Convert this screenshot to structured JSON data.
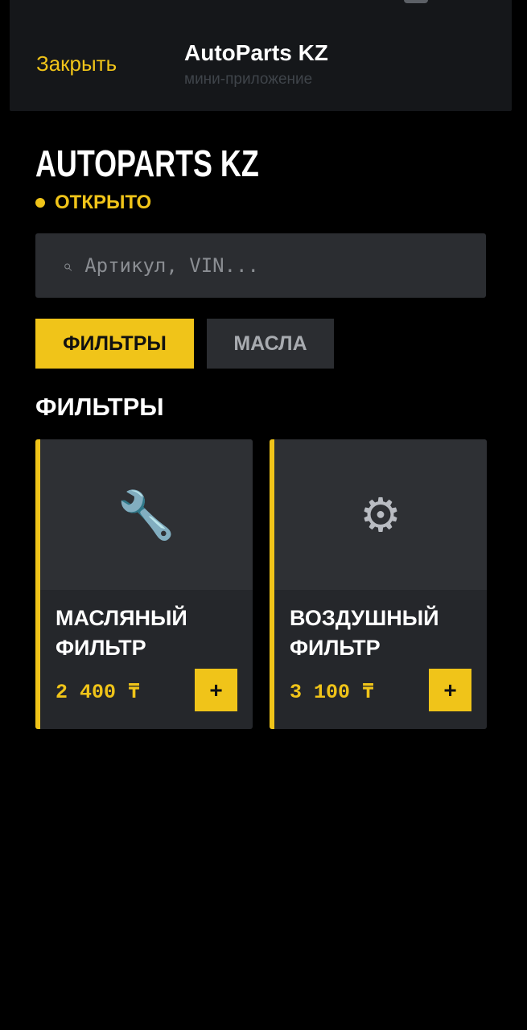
{
  "header": {
    "close_label": "Закрыть",
    "title": "AutoParts KZ",
    "subtitle": "мини-приложение"
  },
  "shop": {
    "name": "AUTOPARTS KZ",
    "status": "ОТКРЫТО"
  },
  "search": {
    "icon": "search-icon",
    "icon_glyph": "⌕",
    "placeholder": "Артикул, VIN...",
    "value": ""
  },
  "tabs": [
    {
      "label": "ФИЛЬТРЫ",
      "active": true
    },
    {
      "label": "МАСЛА",
      "active": false
    }
  ],
  "section_title": "ФИЛЬТРЫ",
  "products": [
    {
      "icon": "wrench-icon",
      "icon_glyph": "🔧",
      "name": "МАСЛЯНЫЙ\nФИЛЬТР",
      "price": "2 400 ₸",
      "add_label": "+"
    },
    {
      "icon": "gear-icon",
      "icon_glyph": "⚙",
      "name": "ВОЗДУШНЫЙ\nФИЛЬТР",
      "price": "3 100 ₸",
      "add_label": "+"
    }
  ],
  "colors": {
    "accent": "#f0c419",
    "background": "#000000",
    "surface": "#2b2d31"
  }
}
